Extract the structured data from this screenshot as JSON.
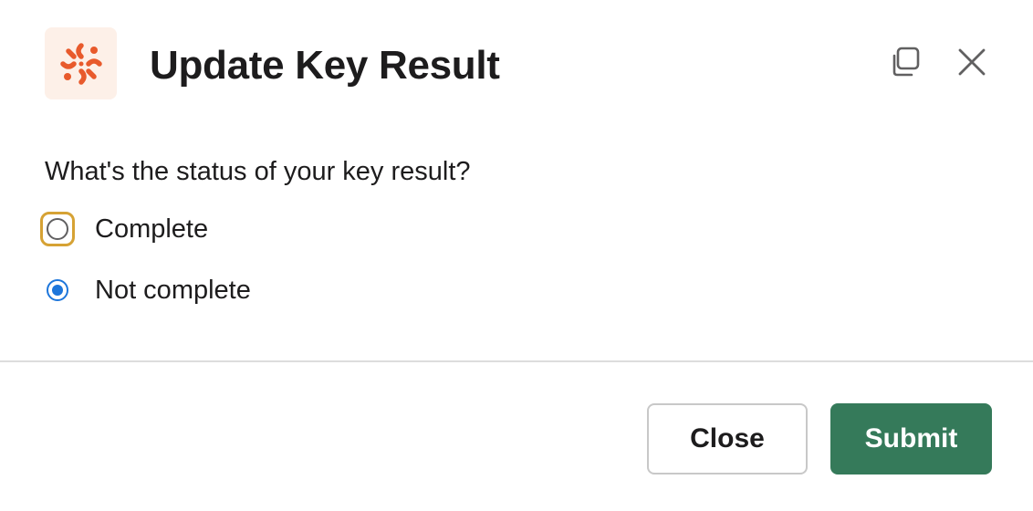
{
  "modal": {
    "title": "Update Key Result",
    "icons": {
      "app_icon": "app-logo-icon",
      "copy": "copy-icon",
      "close": "close-icon"
    },
    "colors": {
      "app_icon_bg": "#fdf0e8",
      "app_icon_fg": "#e85a2c",
      "radio_checked": "#1d76db",
      "focus_ring": "#d6a234",
      "submit_bg": "#357a5a"
    }
  },
  "form": {
    "question": "What's the status of your key result?",
    "options": [
      {
        "label": "Complete",
        "checked": false,
        "focused": true
      },
      {
        "label": "Not complete",
        "checked": true,
        "focused": false
      }
    ]
  },
  "footer": {
    "close_label": "Close",
    "submit_label": "Submit"
  }
}
